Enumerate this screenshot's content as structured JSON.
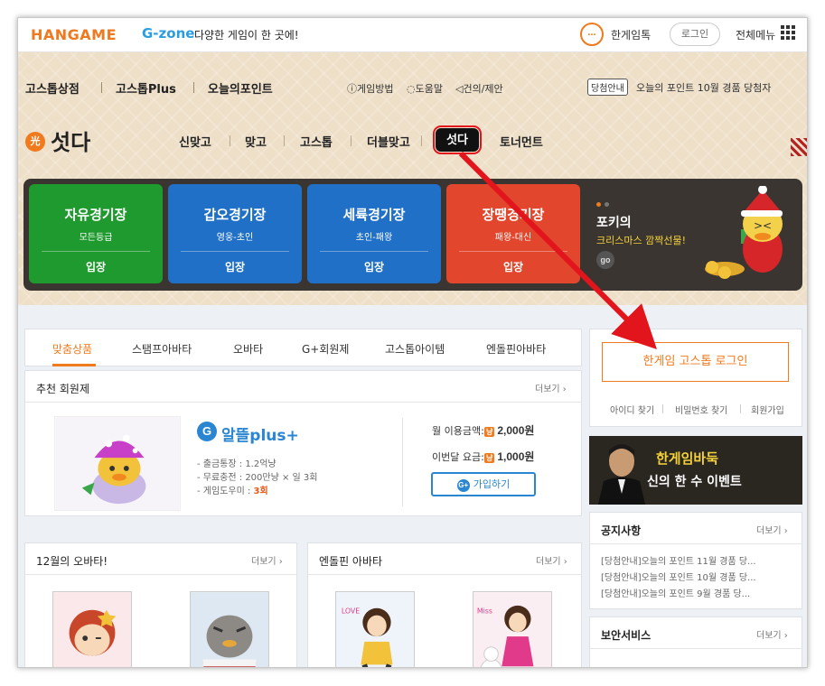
{
  "topbar": {
    "logo": "HANGAME",
    "gzone": "G-zone",
    "gzone_desc": "다양한 게임이 한 곳에!",
    "talk_icon": "...",
    "talk_label": "한게임톡",
    "login_label": "로그인",
    "all_menu_label": "전체메뉴"
  },
  "nav": {
    "main_items": [
      "고스톱상점",
      "고스톱Plus",
      "오늘의포인트"
    ],
    "util_items": [
      "게임방법",
      "도움말",
      "건의/제안"
    ],
    "notice_badge": "당첨안내",
    "notice_text": "오늘의 포인트 10월 경품 당첨자"
  },
  "game": {
    "icon_char": "光",
    "title": "섯다",
    "tabs": [
      "신맞고",
      "맞고",
      "고스톱",
      "더블맞고",
      "섯다",
      "토너먼트"
    ],
    "active_tab": "섯다"
  },
  "rooms": [
    {
      "name": "자유경기장",
      "sub": "모든등급",
      "enter": "입장",
      "color": "#1f9a2e"
    },
    {
      "name": "갑오경기장",
      "sub": "영웅-초인",
      "enter": "입장",
      "color": "#2170c8"
    },
    {
      "name": "세륙경기장",
      "sub": "초인-패왕",
      "enter": "입장",
      "color": "#2170c8"
    },
    {
      "name": "장땡경기장",
      "sub": "패왕-대신",
      "enter": "입장",
      "color": "#e2462c"
    }
  ],
  "promo": {
    "title": "포키의",
    "subtitle": "크리스마스 깜짝선물!",
    "go_label": "go"
  },
  "shop_tabs": [
    "맞춤상품",
    "스탬프아바타",
    "오바타",
    "G+회원제",
    "고스톱아이템",
    "엔돌핀아바타"
  ],
  "membership": {
    "title": "추천 회원제",
    "more": "더보기 ›",
    "logo_g": "G",
    "logo_text": "알뜰plus+",
    "features": [
      "- 출금통장 : 1.2억냥",
      "- 무료충전 : 200만냥 × 일 3회",
      "- 게임도우미 :"
    ],
    "helper_count": "3회",
    "monthly_label": "월 이용금액:",
    "monthly_price": "2,000원",
    "this_month_label": "이번달 요금:",
    "this_month_price": "1,000원",
    "join_label": "가입하기"
  },
  "avatar_sections": [
    {
      "title": "12월의 오바타!",
      "more": "더보기 ›"
    },
    {
      "title": "엔돌핀 아바타",
      "more": "더보기 ›"
    }
  ],
  "login_box": {
    "main_button": "한게임 고스톱 로그인",
    "links": [
      "아이디 찾기",
      "비밀번호 찾기",
      "회원가입"
    ]
  },
  "baduk_banner": {
    "line1": "한게임바둑",
    "line2": "신의 한 수 이벤트"
  },
  "notices": {
    "title": "공지사항",
    "more": "더보기 ›",
    "items": [
      "[당첨안내]오늘의 포인트 11월 경품 당...",
      "[당첨안내]오늘의 포인트 10월 경품 당...",
      "[당첨안내]오늘의 포인트 9월 경품 당..."
    ]
  },
  "security": {
    "title": "보안서비스",
    "more": "더보기 ›"
  },
  "colors": {
    "accent_orange": "#f07a1e",
    "gzone_blue": "#2a9de0",
    "highlight_red": "#e2141c",
    "hero_bg": "#eedfc8"
  }
}
